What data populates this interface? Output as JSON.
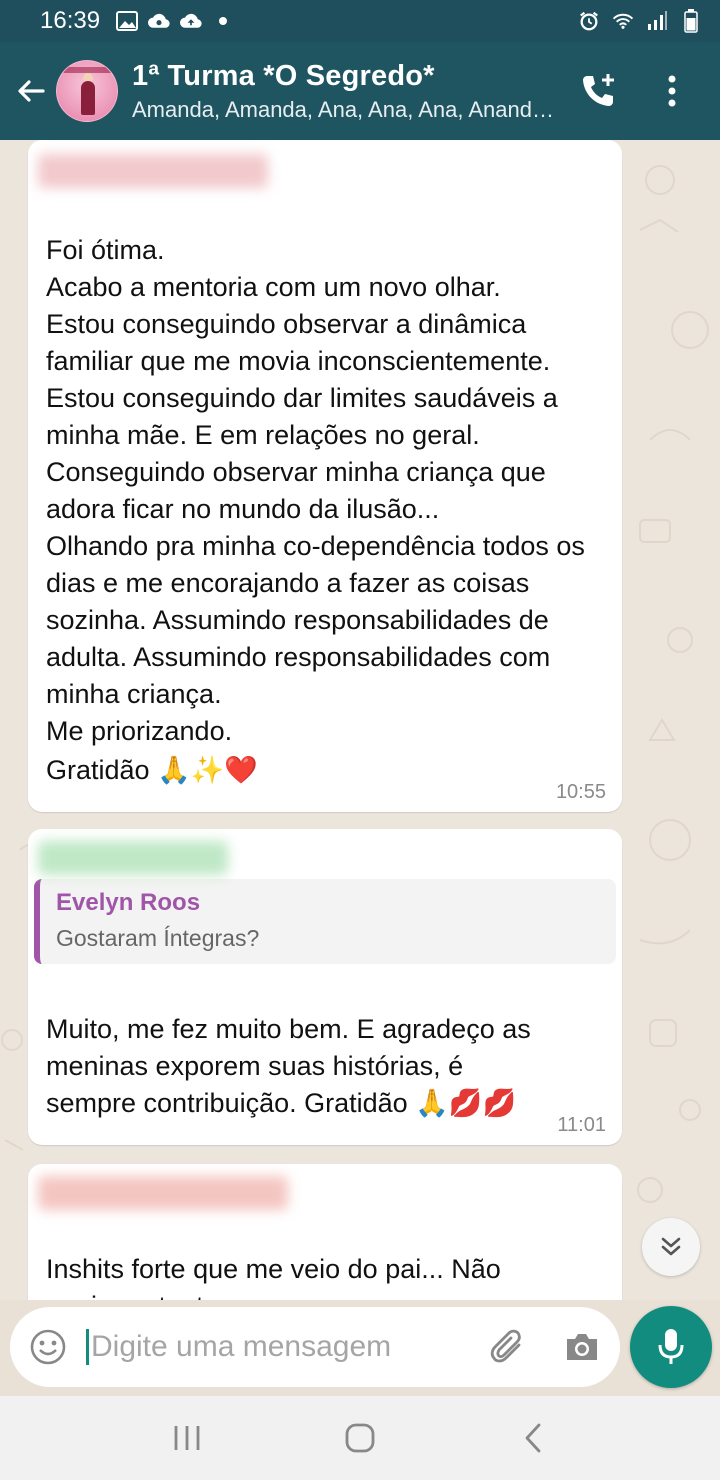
{
  "status_bar": {
    "time": "16:39",
    "left_icons": [
      "image-icon",
      "cloud-sync-icon",
      "cloud-upload-icon",
      "dot-icon"
    ],
    "right_icons": [
      "alarm-icon",
      "wifi-icon",
      "signal-icon",
      "battery-icon"
    ]
  },
  "header": {
    "title": "1ª Turma *O Segredo*",
    "subtitle": "Amanda, Amanda, Ana, Ana, Ana, Anand…",
    "icons": [
      "back-arrow-icon",
      "group-avatar",
      "add-call-icon",
      "more-vert-icon"
    ]
  },
  "messages": [
    {
      "text": "Foi ótima.\nAcabo a mentoria com um novo olhar.\nEstou conseguindo observar a dinâmica familiar que me movia inconscientemente. Estou conseguindo dar limites saudáveis a minha mãe. E em relações no geral.\nConseguindo observar minha criança que adora ficar no mundo da ilusão...\nOlhando pra minha co-dependência todos os dias e me encorajando a fazer as coisas sozinha. Assumindo responsabilidades de adulta. Assumindo responsabilidades com minha criança.\nMe priorizando.",
      "last_line": "Gratidão",
      "emojis": "🙏✨❤️",
      "time": "10:55",
      "sender_color": "#f2c9cc"
    },
    {
      "quote_name": "Evelyn Roos",
      "quote_text": "Gostaram Íntegras?",
      "text": "Muito, me fez muito bem. E agradeço as meninas exporem suas histórias, é",
      "last_line": "sempre contribuição. Gratidão",
      "emojis": "🙏💋💋",
      "time": "11:01",
      "sender_color": "#bfe8c6"
    },
    {
      "text": "Inshits forte que me veio do pai... Não ser importante.",
      "sender_color": "#f4c6c2"
    }
  ],
  "input": {
    "placeholder": "Digite uma mensagem",
    "icons": [
      "emoji-icon",
      "attach-icon",
      "camera-icon",
      "mic-icon"
    ]
  },
  "nav": {
    "icons": [
      "recent-apps-icon",
      "home-icon",
      "back-icon"
    ]
  },
  "colors": {
    "header": "#1f5561",
    "status_bar": "#1f4f5c",
    "accent": "#128c7e",
    "quote_accent": "#a056a8"
  }
}
